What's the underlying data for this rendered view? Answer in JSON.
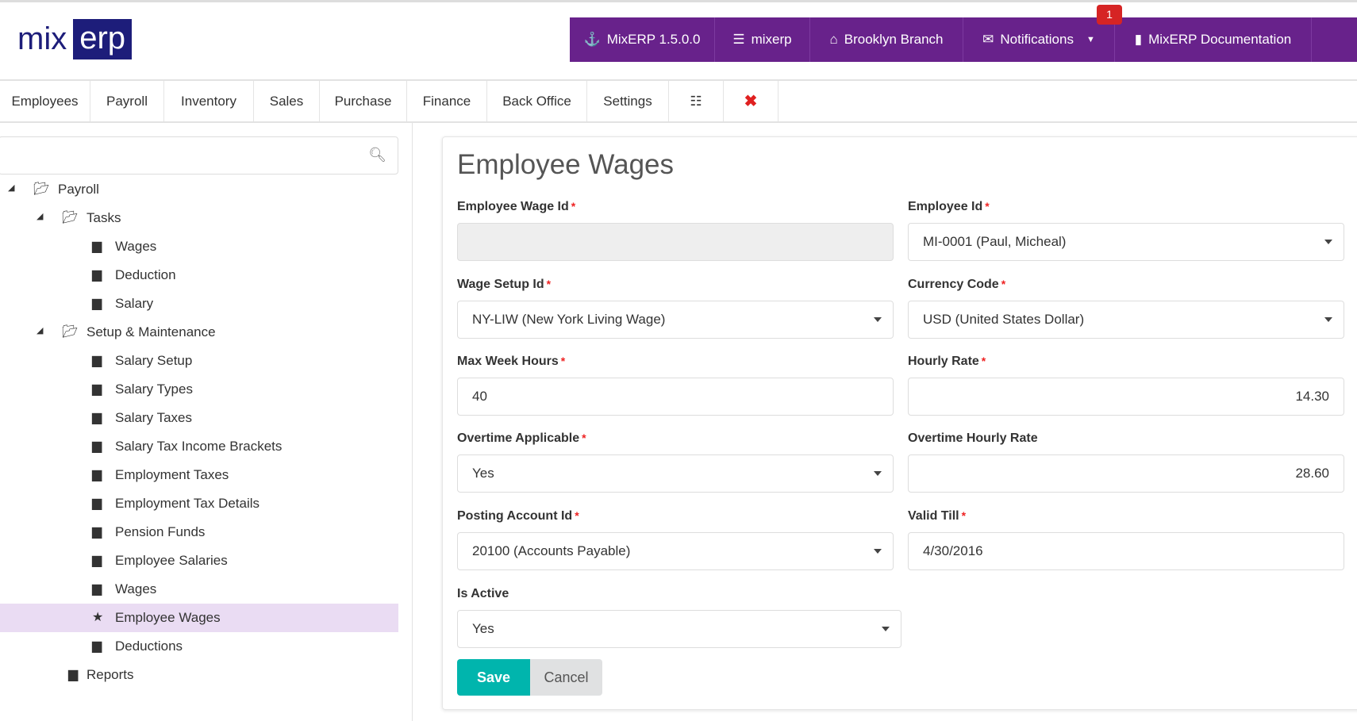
{
  "logo": {
    "part1": "mix",
    "part2": "erp"
  },
  "topbar": {
    "items": [
      {
        "label": "MixERP 1.5.0.0",
        "icon": "anchor-icon"
      },
      {
        "label": "mixerp",
        "icon": "database-icon"
      },
      {
        "label": "Brooklyn Branch",
        "icon": "home-icon"
      },
      {
        "label": "Notifications",
        "icon": "envelope-icon"
      },
      {
        "label": "MixERP Documentation",
        "icon": "book-icon"
      }
    ],
    "notification_count": "1"
  },
  "nav": {
    "tabs": [
      "Employees",
      "Payroll",
      "Inventory",
      "Sales",
      "Purchase",
      "Finance",
      "Back Office",
      "Settings"
    ]
  },
  "sidebar": {
    "search_placeholder": "",
    "tree": [
      {
        "label": "Payroll",
        "type": "folder",
        "level": 0
      },
      {
        "label": "Tasks",
        "type": "folder",
        "level": 1
      },
      {
        "label": "Wages",
        "type": "file",
        "level": 2
      },
      {
        "label": "Deduction",
        "type": "file",
        "level": 2
      },
      {
        "label": "Salary",
        "type": "file",
        "level": 2
      },
      {
        "label": "Setup & Maintenance",
        "type": "folder",
        "level": 1
      },
      {
        "label": "Salary Setup",
        "type": "file",
        "level": 2
      },
      {
        "label": "Salary Types",
        "type": "file",
        "level": 2
      },
      {
        "label": "Salary Taxes",
        "type": "file",
        "level": 2
      },
      {
        "label": "Salary Tax Income Brackets",
        "type": "file",
        "level": 2
      },
      {
        "label": "Employment Taxes",
        "type": "file",
        "level": 2
      },
      {
        "label": "Employment Tax Details",
        "type": "file",
        "level": 2
      },
      {
        "label": "Pension Funds",
        "type": "file",
        "level": 2
      },
      {
        "label": "Employee Salaries",
        "type": "file",
        "level": 2
      },
      {
        "label": "Wages",
        "type": "file",
        "level": 2
      },
      {
        "label": "Employee Wages",
        "type": "star",
        "level": 2,
        "selected": true
      },
      {
        "label": "Deductions",
        "type": "file",
        "level": 2
      },
      {
        "label": "Reports",
        "type": "file",
        "level": 1
      }
    ]
  },
  "form": {
    "title": "Employee Wages",
    "fields": {
      "employee_wage_id": {
        "label": "Employee Wage Id",
        "value": ""
      },
      "employee_id": {
        "label": "Employee Id",
        "value": "MI-0001 (Paul, Micheal)"
      },
      "wage_setup_id": {
        "label": "Wage Setup Id",
        "value": "NY-LIW (New York Living Wage)"
      },
      "currency_code": {
        "label": "Currency Code",
        "value": "USD (United States Dollar)"
      },
      "max_week_hours": {
        "label": "Max Week Hours",
        "value": "40"
      },
      "hourly_rate": {
        "label": "Hourly Rate",
        "value": "14.30"
      },
      "overtime_applicable": {
        "label": "Overtime Applicable",
        "value": "Yes"
      },
      "overtime_hourly_rate": {
        "label": "Overtime Hourly Rate",
        "value": "28.60"
      },
      "posting_account_id": {
        "label": "Posting Account Id",
        "value": "20100 (Accounts Payable)"
      },
      "valid_till": {
        "label": "Valid Till",
        "value": "4/30/2016"
      },
      "is_active": {
        "label": "Is Active",
        "value": "Yes"
      }
    },
    "required_mark": "*",
    "save_label": "Save",
    "cancel_label": "Cancel"
  },
  "colors": {
    "brand": "#68228b",
    "logo": "#1d1d7a",
    "save": "#00b5ad",
    "selected": "#eadcf3"
  }
}
